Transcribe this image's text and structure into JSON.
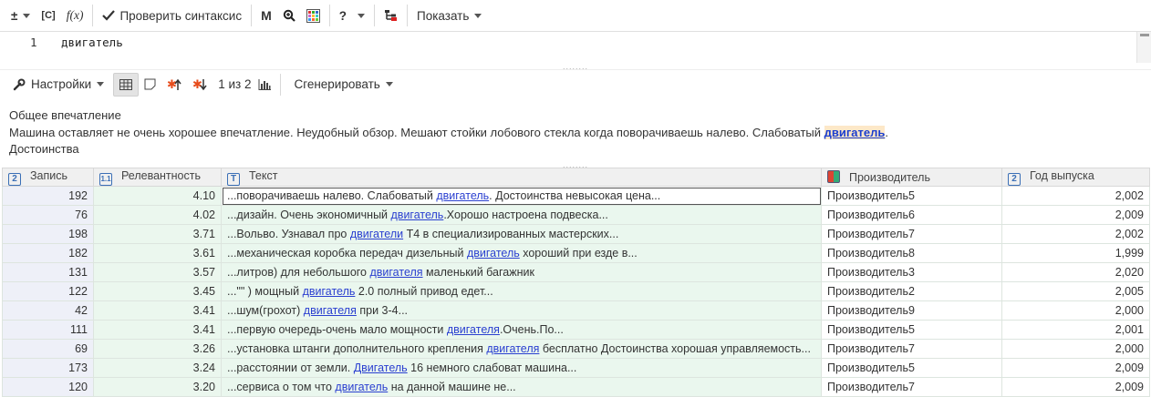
{
  "toolbar": {
    "plusminus_label": "±",
    "brackets_label": "[C]",
    "fx_label": "f(x)",
    "check_syntax_label": "Проверить синтаксис",
    "m_label": "M",
    "help_label": "?",
    "show_label": "Показать"
  },
  "editor": {
    "line_number": "1",
    "line_text": "двигатель"
  },
  "toolbar2": {
    "settings_label": "Настройки",
    "pager_label": "1 из 2",
    "generate_label": "Сгенерировать"
  },
  "preview": {
    "line1": "Общее впечатление",
    "line2_before": "Машина оставляет не очень хорошее впечатление. Неудобный обзор. Мешают стойки лобового стекла когда поворачиваешь налево. Слабоватый ",
    "line2_highlight": "двигатель",
    "line2_after": ".",
    "line3": "Достоинства"
  },
  "table": {
    "headers": {
      "id": "Запись",
      "relevance": "Релевантность",
      "text": "Текст",
      "manufacturer": "Производитель",
      "year": "Год выпуска"
    },
    "header_icons": {
      "id": "2",
      "relevance": "1.1",
      "text": "T",
      "year": "2"
    },
    "rows": [
      {
        "id": "192",
        "rel": "4.10",
        "pre": "...поворачиваешь налево. Слабоватый ",
        "kw": "двигатель",
        "post": ". Достоинства невысокая цена...",
        "man": "Производитель5",
        "year": "2,002"
      },
      {
        "id": "76",
        "rel": "4.02",
        "pre": "...дизайн. Очень экономичный ",
        "kw": "двигатель",
        "post": ".Хорошо настроена подвеска...",
        "man": "Производитель6",
        "year": "2,009"
      },
      {
        "id": "198",
        "rel": "3.71",
        "pre": "...Вольво. Узнавал про ",
        "kw": "двигатели",
        "post": " Т4 в специализированных мастерских...",
        "man": "Производитель7",
        "year": "2,002"
      },
      {
        "id": "182",
        "rel": "3.61",
        "pre": "...механическая коробка передач дизельный ",
        "kw": "двигатель",
        "post": " хороший при езде в...",
        "man": "Производитель8",
        "year": "1,999"
      },
      {
        "id": "131",
        "rel": "3.57",
        "pre": "...литров) для небольшого ",
        "kw": "двигателя",
        "post": " маленький багажник",
        "man": "Производитель3",
        "year": "2,020"
      },
      {
        "id": "122",
        "rel": "3.45",
        "pre": "...\"\" ) мощный ",
        "kw": "двигатель",
        "post": " 2.0 полный привод едет...",
        "man": "Производитель2",
        "year": "2,005"
      },
      {
        "id": "42",
        "rel": "3.41",
        "pre": "...шум(грохот) ",
        "kw": "двигателя",
        "post": " при 3-4...",
        "man": "Производитель9",
        "year": "2,000"
      },
      {
        "id": "111",
        "rel": "3.41",
        "pre": "...первую очередь-очень мало мощности ",
        "kw": "двигателя",
        "post": ".Очень.По...",
        "man": "Производитель5",
        "year": "2,001"
      },
      {
        "id": "69",
        "rel": "3.26",
        "pre": "...установка штанги дополнительного крепления ",
        "kw": "двигателя",
        "post": " бесплатно Достоинства хорошая управляемость...",
        "man": "Производитель7",
        "year": "2,000"
      },
      {
        "id": "173",
        "rel": "3.24",
        "pre": "...расстоянии от земли. ",
        "kw": "Двигатель",
        "post": " 16 немного слабоват машина...",
        "man": "Производитель5",
        "year": "2,009"
      },
      {
        "id": "120",
        "rel": "3.20",
        "pre": "...сервиса о том что ",
        "kw": "двигатель",
        "post": " на данной машине не...",
        "man": "Производитель7",
        "year": "2,009"
      }
    ]
  }
}
